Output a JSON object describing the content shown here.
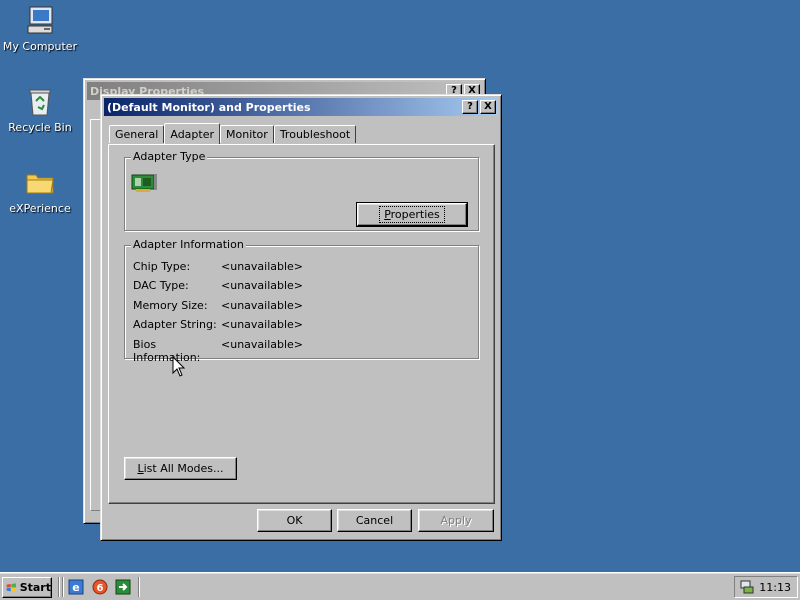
{
  "desktop": {
    "icons": [
      {
        "label": "My Computer",
        "icon": "my-computer-icon"
      },
      {
        "label": "Recycle Bin",
        "icon": "recycle-bin-icon"
      },
      {
        "label": "eXPerience",
        "icon": "folder-icon"
      }
    ]
  },
  "back_window": {
    "title": "Display Properties",
    "help_label": "?",
    "close_label": "X"
  },
  "dialog": {
    "title": "(Default Monitor) and  Properties",
    "help_label": "?",
    "close_label": "X",
    "tabs": [
      {
        "label": "General",
        "selected": false
      },
      {
        "label": "Adapter",
        "selected": true
      },
      {
        "label": "Monitor",
        "selected": false
      },
      {
        "label": "Troubleshoot",
        "selected": false
      }
    ],
    "adapter_type": {
      "group_title": "Adapter Type",
      "properties_button": {
        "accel": "P",
        "rest": "roperties"
      }
    },
    "adapter_info": {
      "group_title": "Adapter Information",
      "rows": [
        {
          "key": "Chip Type:",
          "value": "<unavailable>"
        },
        {
          "key": "DAC Type:",
          "value": "<unavailable>"
        },
        {
          "key": "Memory Size:",
          "value": "<unavailable>"
        },
        {
          "key": "Adapter String:",
          "value": "<unavailable>"
        },
        {
          "key": "Bios Information:",
          "value": "<unavailable>"
        }
      ]
    },
    "list_modes_button": {
      "accel": "L",
      "rest": "ist All Modes..."
    },
    "ok_label": "OK",
    "cancel_label": "Cancel",
    "apply_label": "Apply"
  },
  "taskbar": {
    "start_label": "Start",
    "quick_launch": [
      "internet-explorer-icon",
      "browser-icon",
      "show-desktop-icon"
    ],
    "clock": "11:13"
  }
}
